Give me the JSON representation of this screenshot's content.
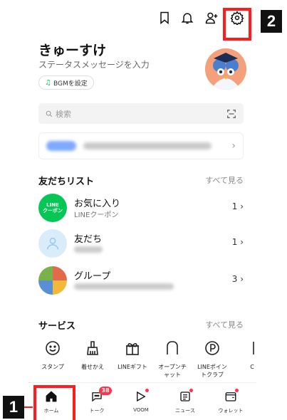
{
  "profile": {
    "name": "きゅーすけ",
    "status_placeholder": "ステータスメッセージを入力",
    "bgm_label": "BGMを設定"
  },
  "search": {
    "placeholder": "検索"
  },
  "friends_section": {
    "title": "友だちリスト",
    "see_all": "すべて見る"
  },
  "friends": [
    {
      "name": "お気に入り",
      "sub": "LINEクーポン",
      "count": "1",
      "icon_text_1": "LINE",
      "icon_text_2": "クーポン"
    },
    {
      "name": "友だち",
      "count": "1"
    },
    {
      "name": "グループ",
      "count": "3"
    }
  ],
  "services_section": {
    "title": "サービス",
    "see_all": "すべて見る"
  },
  "services": [
    {
      "label": "スタンプ",
      "icon": "smile-icon"
    },
    {
      "label": "着せかえ",
      "icon": "brush-icon"
    },
    {
      "label": "LINEギフト",
      "icon": "gift-icon"
    },
    {
      "label": "オープンチ\nャット",
      "icon": "openchat-icon"
    },
    {
      "label": "LINEポイン\nトクラブ",
      "icon": "points-icon"
    },
    {
      "label": "C",
      "icon": "more-service-icon"
    }
  ],
  "tabs": [
    {
      "label": "ホーム",
      "icon": "home-icon"
    },
    {
      "label": "トーク",
      "icon": "chat-icon",
      "badge": "38"
    },
    {
      "label": "VOOM",
      "icon": "voom-icon"
    },
    {
      "label": "ニュース",
      "icon": "news-icon"
    },
    {
      "label": "ウォレット",
      "icon": "wallet-icon"
    }
  ],
  "annotations": {
    "step1": "1",
    "step2": "2"
  },
  "colors": {
    "line_green": "#06c755",
    "badge_red": "#ff334b",
    "highlight_red": "#ff1c1c"
  }
}
